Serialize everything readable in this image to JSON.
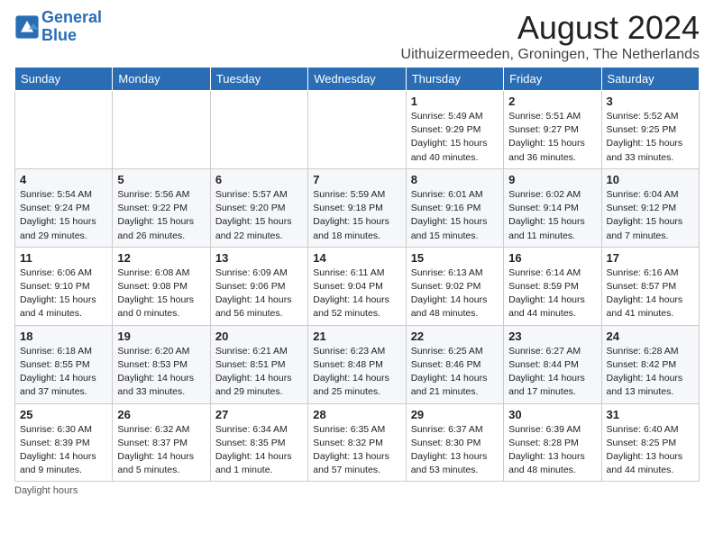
{
  "header": {
    "logo_line1": "General",
    "logo_line2": "Blue",
    "title": "August 2024",
    "subtitle": "Uithuizermeeden, Groningen, The Netherlands"
  },
  "days_of_week": [
    "Sunday",
    "Monday",
    "Tuesday",
    "Wednesday",
    "Thursday",
    "Friday",
    "Saturday"
  ],
  "weeks": [
    [
      {
        "day": "",
        "info": ""
      },
      {
        "day": "",
        "info": ""
      },
      {
        "day": "",
        "info": ""
      },
      {
        "day": "",
        "info": ""
      },
      {
        "day": "1",
        "info": "Sunrise: 5:49 AM\nSunset: 9:29 PM\nDaylight: 15 hours\nand 40 minutes."
      },
      {
        "day": "2",
        "info": "Sunrise: 5:51 AM\nSunset: 9:27 PM\nDaylight: 15 hours\nand 36 minutes."
      },
      {
        "day": "3",
        "info": "Sunrise: 5:52 AM\nSunset: 9:25 PM\nDaylight: 15 hours\nand 33 minutes."
      }
    ],
    [
      {
        "day": "4",
        "info": "Sunrise: 5:54 AM\nSunset: 9:24 PM\nDaylight: 15 hours\nand 29 minutes."
      },
      {
        "day": "5",
        "info": "Sunrise: 5:56 AM\nSunset: 9:22 PM\nDaylight: 15 hours\nand 26 minutes."
      },
      {
        "day": "6",
        "info": "Sunrise: 5:57 AM\nSunset: 9:20 PM\nDaylight: 15 hours\nand 22 minutes."
      },
      {
        "day": "7",
        "info": "Sunrise: 5:59 AM\nSunset: 9:18 PM\nDaylight: 15 hours\nand 18 minutes."
      },
      {
        "day": "8",
        "info": "Sunrise: 6:01 AM\nSunset: 9:16 PM\nDaylight: 15 hours\nand 15 minutes."
      },
      {
        "day": "9",
        "info": "Sunrise: 6:02 AM\nSunset: 9:14 PM\nDaylight: 15 hours\nand 11 minutes."
      },
      {
        "day": "10",
        "info": "Sunrise: 6:04 AM\nSunset: 9:12 PM\nDaylight: 15 hours\nand 7 minutes."
      }
    ],
    [
      {
        "day": "11",
        "info": "Sunrise: 6:06 AM\nSunset: 9:10 PM\nDaylight: 15 hours\nand 4 minutes."
      },
      {
        "day": "12",
        "info": "Sunrise: 6:08 AM\nSunset: 9:08 PM\nDaylight: 15 hours\nand 0 minutes."
      },
      {
        "day": "13",
        "info": "Sunrise: 6:09 AM\nSunset: 9:06 PM\nDaylight: 14 hours\nand 56 minutes."
      },
      {
        "day": "14",
        "info": "Sunrise: 6:11 AM\nSunset: 9:04 PM\nDaylight: 14 hours\nand 52 minutes."
      },
      {
        "day": "15",
        "info": "Sunrise: 6:13 AM\nSunset: 9:02 PM\nDaylight: 14 hours\nand 48 minutes."
      },
      {
        "day": "16",
        "info": "Sunrise: 6:14 AM\nSunset: 8:59 PM\nDaylight: 14 hours\nand 44 minutes."
      },
      {
        "day": "17",
        "info": "Sunrise: 6:16 AM\nSunset: 8:57 PM\nDaylight: 14 hours\nand 41 minutes."
      }
    ],
    [
      {
        "day": "18",
        "info": "Sunrise: 6:18 AM\nSunset: 8:55 PM\nDaylight: 14 hours\nand 37 minutes."
      },
      {
        "day": "19",
        "info": "Sunrise: 6:20 AM\nSunset: 8:53 PM\nDaylight: 14 hours\nand 33 minutes."
      },
      {
        "day": "20",
        "info": "Sunrise: 6:21 AM\nSunset: 8:51 PM\nDaylight: 14 hours\nand 29 minutes."
      },
      {
        "day": "21",
        "info": "Sunrise: 6:23 AM\nSunset: 8:48 PM\nDaylight: 14 hours\nand 25 minutes."
      },
      {
        "day": "22",
        "info": "Sunrise: 6:25 AM\nSunset: 8:46 PM\nDaylight: 14 hours\nand 21 minutes."
      },
      {
        "day": "23",
        "info": "Sunrise: 6:27 AM\nSunset: 8:44 PM\nDaylight: 14 hours\nand 17 minutes."
      },
      {
        "day": "24",
        "info": "Sunrise: 6:28 AM\nSunset: 8:42 PM\nDaylight: 14 hours\nand 13 minutes."
      }
    ],
    [
      {
        "day": "25",
        "info": "Sunrise: 6:30 AM\nSunset: 8:39 PM\nDaylight: 14 hours\nand 9 minutes."
      },
      {
        "day": "26",
        "info": "Sunrise: 6:32 AM\nSunset: 8:37 PM\nDaylight: 14 hours\nand 5 minutes."
      },
      {
        "day": "27",
        "info": "Sunrise: 6:34 AM\nSunset: 8:35 PM\nDaylight: 14 hours\nand 1 minute."
      },
      {
        "day": "28",
        "info": "Sunrise: 6:35 AM\nSunset: 8:32 PM\nDaylight: 13 hours\nand 57 minutes."
      },
      {
        "day": "29",
        "info": "Sunrise: 6:37 AM\nSunset: 8:30 PM\nDaylight: 13 hours\nand 53 minutes."
      },
      {
        "day": "30",
        "info": "Sunrise: 6:39 AM\nSunset: 8:28 PM\nDaylight: 13 hours\nand 48 minutes."
      },
      {
        "day": "31",
        "info": "Sunrise: 6:40 AM\nSunset: 8:25 PM\nDaylight: 13 hours\nand 44 minutes."
      }
    ]
  ],
  "footer": {
    "note": "Daylight hours"
  }
}
